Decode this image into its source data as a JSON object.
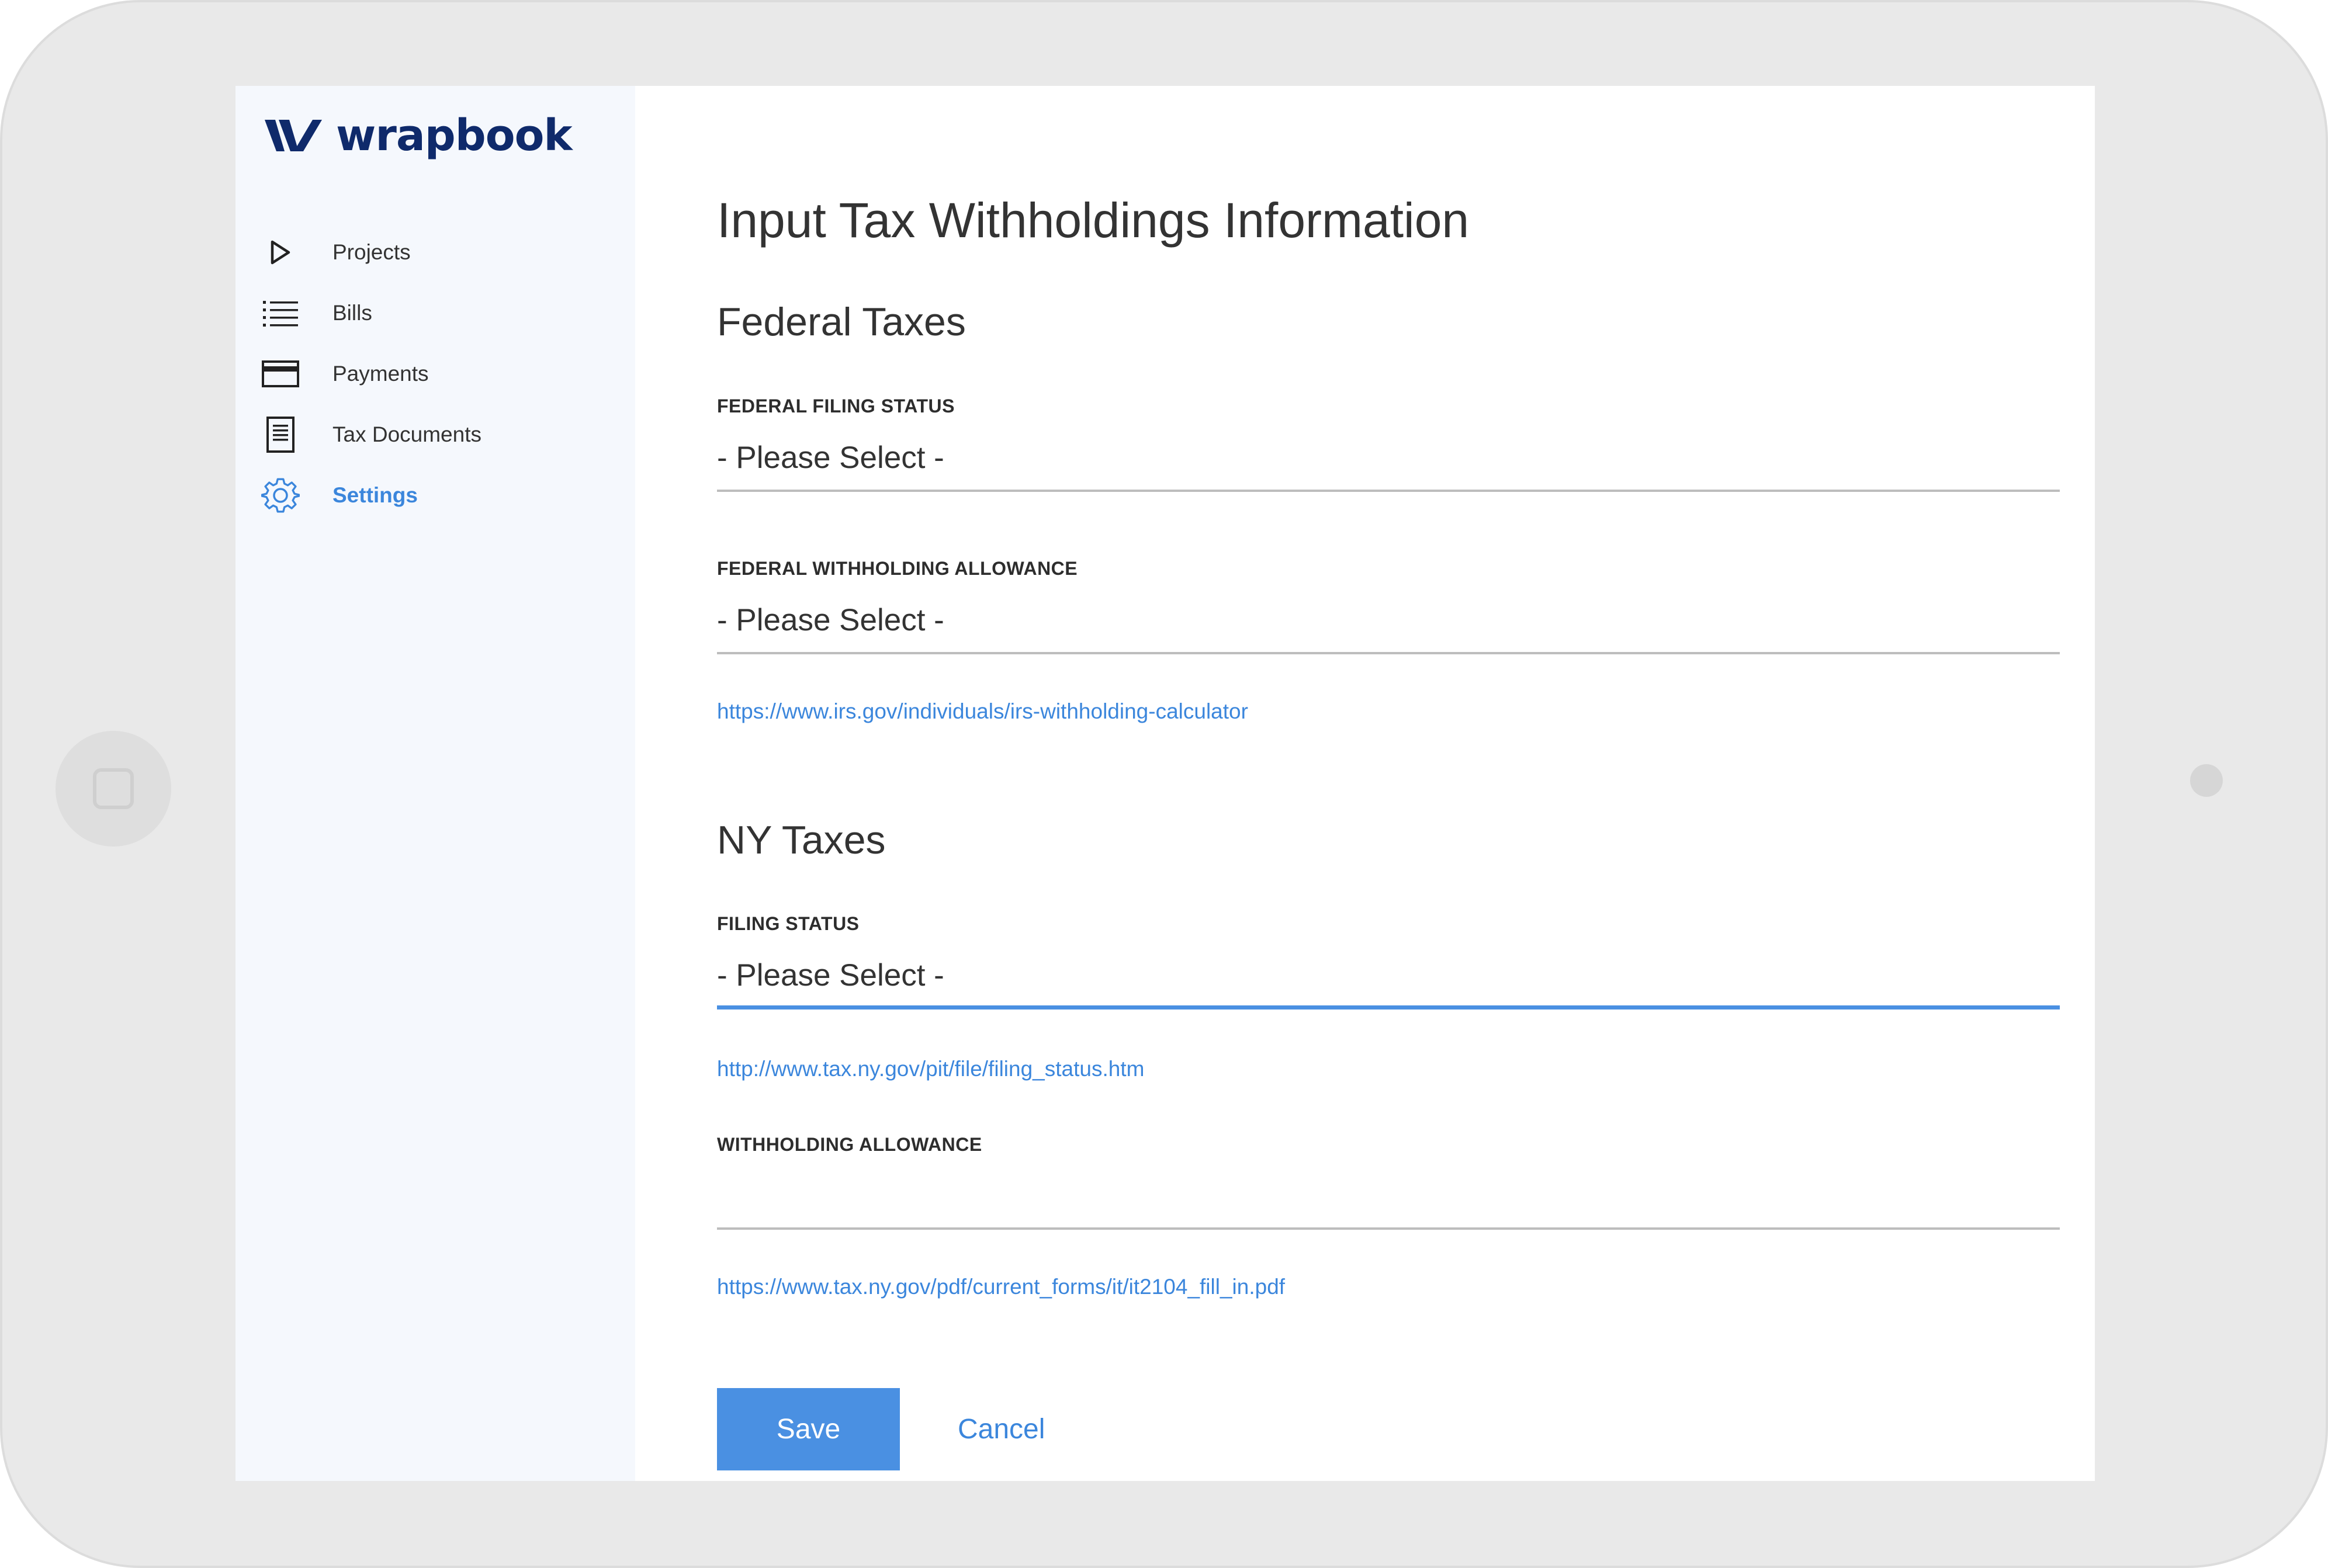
{
  "app": {
    "logo_text": "wrapbook"
  },
  "sidebar": {
    "items": [
      {
        "label": "Projects",
        "icon": "play-outline-icon",
        "active": false
      },
      {
        "label": "Bills",
        "icon": "list-icon",
        "active": false
      },
      {
        "label": "Payments",
        "icon": "credit-card-icon",
        "active": false
      },
      {
        "label": "Tax Documents",
        "icon": "document-icon",
        "active": false
      },
      {
        "label": "Settings",
        "icon": "gear-icon",
        "active": true
      }
    ]
  },
  "main": {
    "title": "Input Tax Withholdings Information",
    "federal": {
      "section_title": "Federal Taxes",
      "filing_status_label": "FEDERAL FILING STATUS",
      "filing_status_value": "- Please Select -",
      "withholding_label": "FEDERAL WITHHOLDING ALLOWANCE",
      "withholding_value": "- Please Select -",
      "link": "https://www.irs.gov/individuals/irs-withholding-calculator"
    },
    "ny": {
      "section_title": "NY Taxes",
      "filing_status_label": "FILING STATUS",
      "filing_status_value": "- Please Select -",
      "filing_link": "http://www.tax.ny.gov/pit/file/filing_status.htm",
      "withholding_label": "WITHHOLDING ALLOWANCE",
      "withholding_value": "",
      "withholding_link": "https://www.tax.ny.gov/pdf/current_forms/it/it2104_fill_in.pdf"
    },
    "actions": {
      "save_label": "Save",
      "cancel_label": "Cancel"
    }
  },
  "colors": {
    "brand_navy": "#0f2a6b",
    "accent_blue": "#4a90e2",
    "link_blue": "#3b86dc",
    "sidebar_bg": "#f5f8fd"
  }
}
